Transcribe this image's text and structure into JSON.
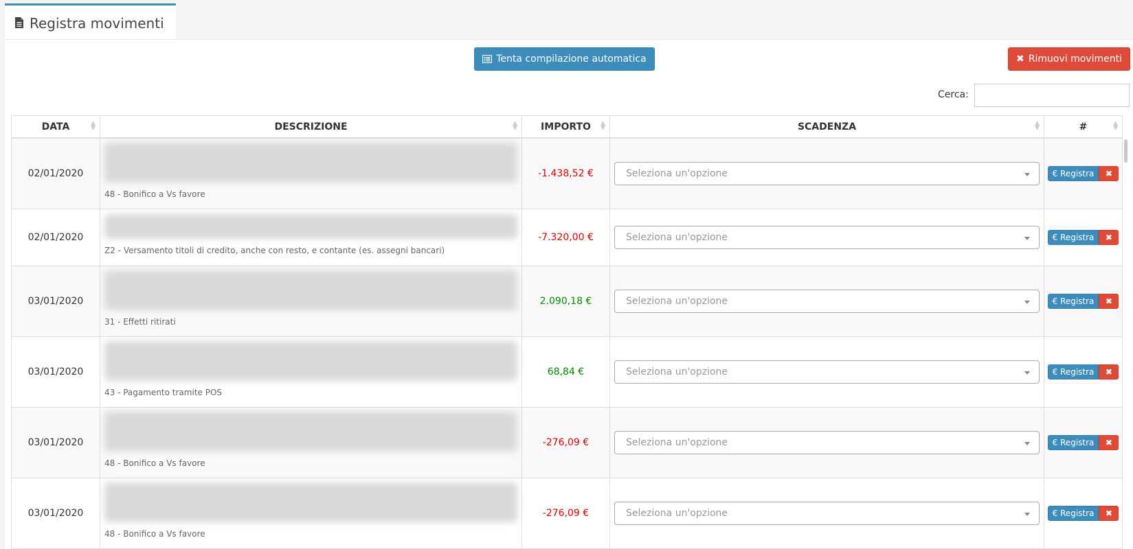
{
  "tab": {
    "title": "Registra movimenti",
    "icon": "document-icon"
  },
  "toolbar": {
    "auto_label": "Tenta compilazione automatica",
    "remove_label": "Rimuovi movimenti"
  },
  "search": {
    "label": "Cerca:",
    "value": ""
  },
  "table": {
    "columns": [
      "DATA",
      "DESCRIZIONE",
      "IMPORTO",
      "SCADENZA",
      "#"
    ],
    "select_placeholder": "Seleziona un'opzione",
    "register_label": "€ Registra",
    "delete_label": "✖",
    "rows": [
      {
        "date": "02/01/2020",
        "sub": "48 - Bonifico a Vs favore",
        "amount": "-1.438,52 €",
        "sign": "neg"
      },
      {
        "date": "02/01/2020",
        "sub": "Z2 - Versamento titoli di credito, anche con resto, e contante (es. assegni bancari)",
        "amount": "-7.320,00 €",
        "sign": "neg"
      },
      {
        "date": "03/01/2020",
        "sub": "31 - Effetti ritirati",
        "amount": "2.090,18 €",
        "sign": "pos"
      },
      {
        "date": "03/01/2020",
        "sub": "43 - Pagamento tramite POS",
        "amount": "68,84 €",
        "sign": "pos"
      },
      {
        "date": "03/01/2020",
        "sub": "48 - Bonifico a Vs favore",
        "amount": "-276,09 €",
        "sign": "neg"
      },
      {
        "date": "03/01/2020",
        "sub": "48 - Bonifico a Vs favore",
        "amount": "-276,09 €",
        "sign": "neg"
      }
    ]
  }
}
